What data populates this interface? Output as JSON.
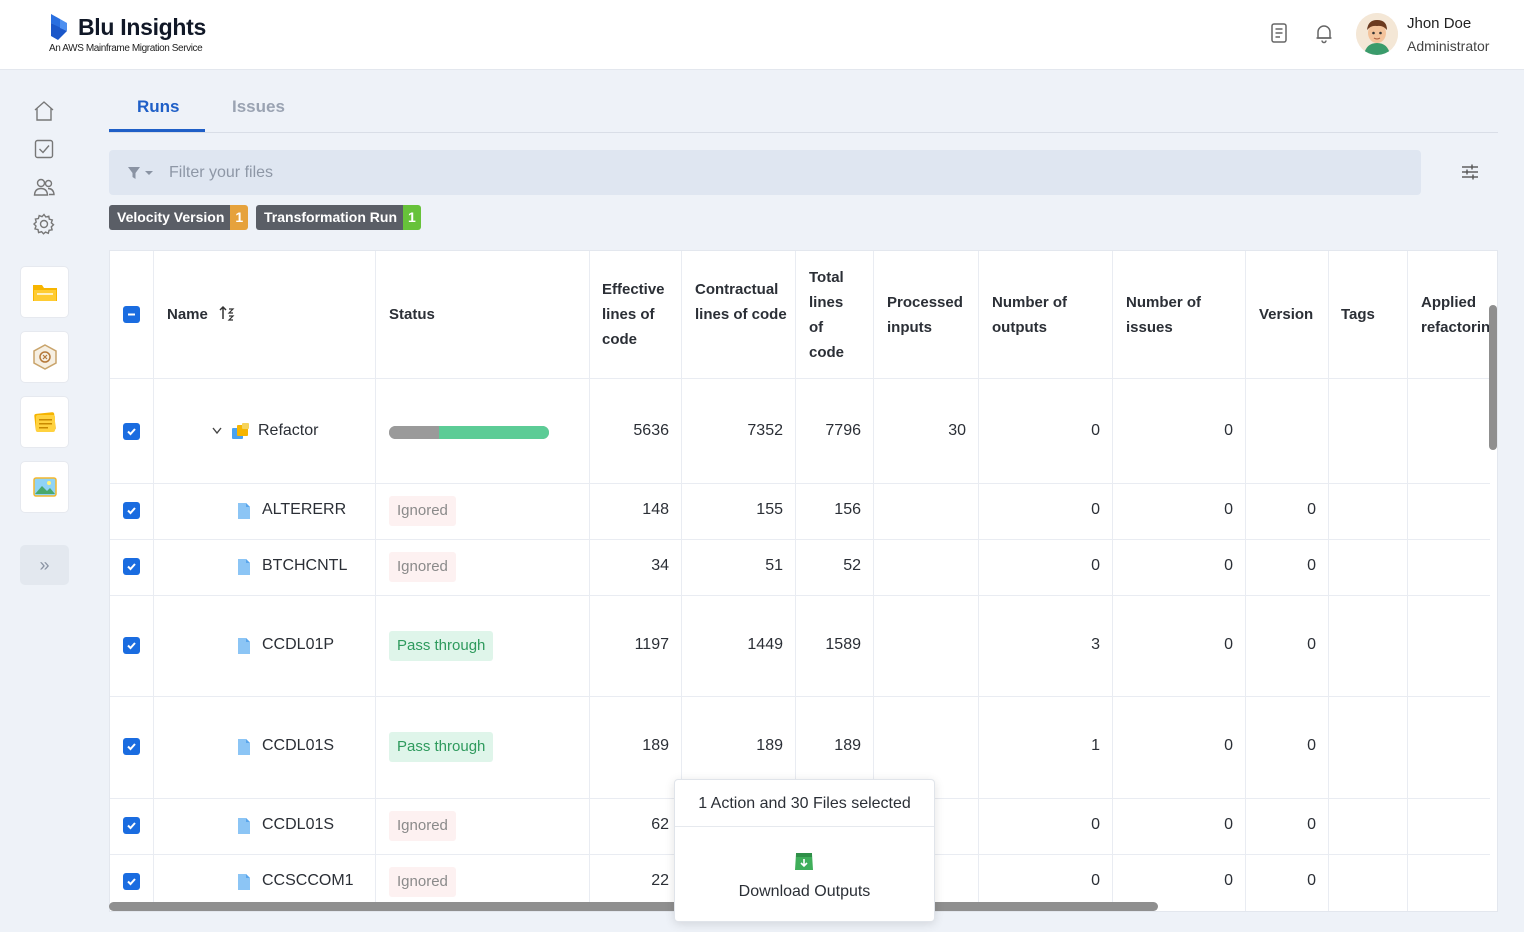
{
  "header": {
    "app_title": "Blu Insights",
    "app_subtitle": "An AWS Mainframe Migration Service",
    "user_name": "Jhon Doe",
    "user_role": "Administrator"
  },
  "tabs": [
    {
      "label": "Runs",
      "active": true
    },
    {
      "label": "Issues",
      "active": false
    }
  ],
  "filter": {
    "placeholder": "Filter your files"
  },
  "chips": [
    {
      "label": "Velocity Version",
      "count": "1",
      "color": "#e6a23c"
    },
    {
      "label": "Transformation Run",
      "count": "1",
      "color": "#67c23a"
    }
  ],
  "table": {
    "columns": [
      "Name",
      "Status",
      "Effective lines of code",
      "Contractual lines of code",
      "Total lines of code",
      "Processed inputs",
      "Number of outputs",
      "Number of issues",
      "Version",
      "Tags",
      "Applied refactorin"
    ],
    "group_row": {
      "name": "Refactor",
      "progress_ignored_fraction": 0.3,
      "effective": "5636",
      "contractual": "7352",
      "total": "7796",
      "processed": "30",
      "outputs": "0",
      "issues": "0"
    },
    "rows": [
      {
        "name": "ALTERERR",
        "status": "Ignored",
        "effective": "148",
        "contractual": "155",
        "total": "156",
        "outputs": "0",
        "issues": "0",
        "version": "0"
      },
      {
        "name": "BTCHCNTL",
        "status": "Ignored",
        "effective": "34",
        "contractual": "51",
        "total": "52",
        "outputs": "0",
        "issues": "0",
        "version": "0"
      },
      {
        "name": "CCDL01P",
        "status": "Pass through",
        "effective": "1197",
        "contractual": "1449",
        "total": "1589",
        "outputs": "3",
        "issues": "0",
        "version": "0"
      },
      {
        "name": "CCDL01S",
        "status": "Pass through",
        "effective": "189",
        "contractual": "189",
        "total": "189",
        "outputs": "1",
        "issues": "0",
        "version": "0"
      },
      {
        "name": "CCDL01S",
        "status": "Ignored",
        "effective": "62",
        "contractual": "",
        "total": "",
        "outputs": "0",
        "issues": "0",
        "version": "0"
      },
      {
        "name": "CCSCCOM1",
        "status": "Ignored",
        "effective": "22",
        "contractual": "",
        "total": "",
        "outputs": "0",
        "issues": "0",
        "version": "0"
      }
    ]
  },
  "popup": {
    "title": "1 Action and 30 Files selected",
    "action_label": "Download Outputs"
  },
  "icons": {
    "sidebar": [
      "home-icon",
      "tasks-icon",
      "users-icon",
      "settings-icon"
    ],
    "sidebar_cards": [
      "folder-icon",
      "codebase-icon",
      "notes-icon",
      "image-icon"
    ]
  }
}
